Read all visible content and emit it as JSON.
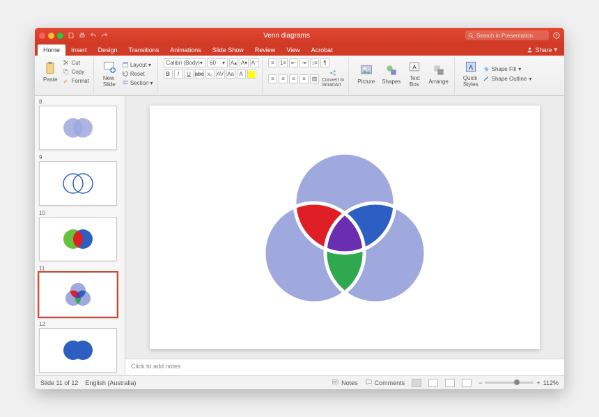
{
  "window": {
    "title": "Venn diagrams"
  },
  "search": {
    "placeholder": "Search in Presentation"
  },
  "share": {
    "label": "Share"
  },
  "tabs": [
    "Home",
    "Insert",
    "Design",
    "Transitions",
    "Animations",
    "Slide Show",
    "Review",
    "View",
    "Acrobat"
  ],
  "active_tab": "Home",
  "ribbon": {
    "paste": "Paste",
    "cut": "Cut",
    "copy": "Copy",
    "format": "Format",
    "new_slide": "New\nSlide",
    "layout": "Layout",
    "reset": "Reset",
    "section": "Section",
    "font_name": "Calibri (Body)",
    "font_size": "60",
    "convert": "Convert to\nSmartArt",
    "picture": "Picture",
    "shapes": "Shapes",
    "textbox": "Text\nBox",
    "arrange": "Arrange",
    "quick_styles": "Quick\nStyles",
    "shape_fill": "Shape Fill",
    "shape_outline": "Shape Outline"
  },
  "thumbs": [
    {
      "n": "8",
      "type": "venn2-light"
    },
    {
      "n": "9",
      "type": "venn2-outline"
    },
    {
      "n": "10",
      "type": "venn2-rgb"
    },
    {
      "n": "11",
      "type": "venn3",
      "selected": true
    },
    {
      "n": "12",
      "type": "venn2-blue"
    }
  ],
  "notes_placeholder": "Click to add notes",
  "status": {
    "slide": "Slide 11 of 12",
    "lang": "English (Australia)",
    "notes": "Notes",
    "comments": "Comments",
    "zoom": "112%"
  },
  "colors": {
    "brand": "#d13a26",
    "circle_light": "#9fa9dd",
    "circle_blue": "#2c5fc1",
    "circle_green": "#2fa84f",
    "circle_red": "#e01e26",
    "circle_purple": "#6a2fb0",
    "circle_lime": "#66c23a"
  }
}
